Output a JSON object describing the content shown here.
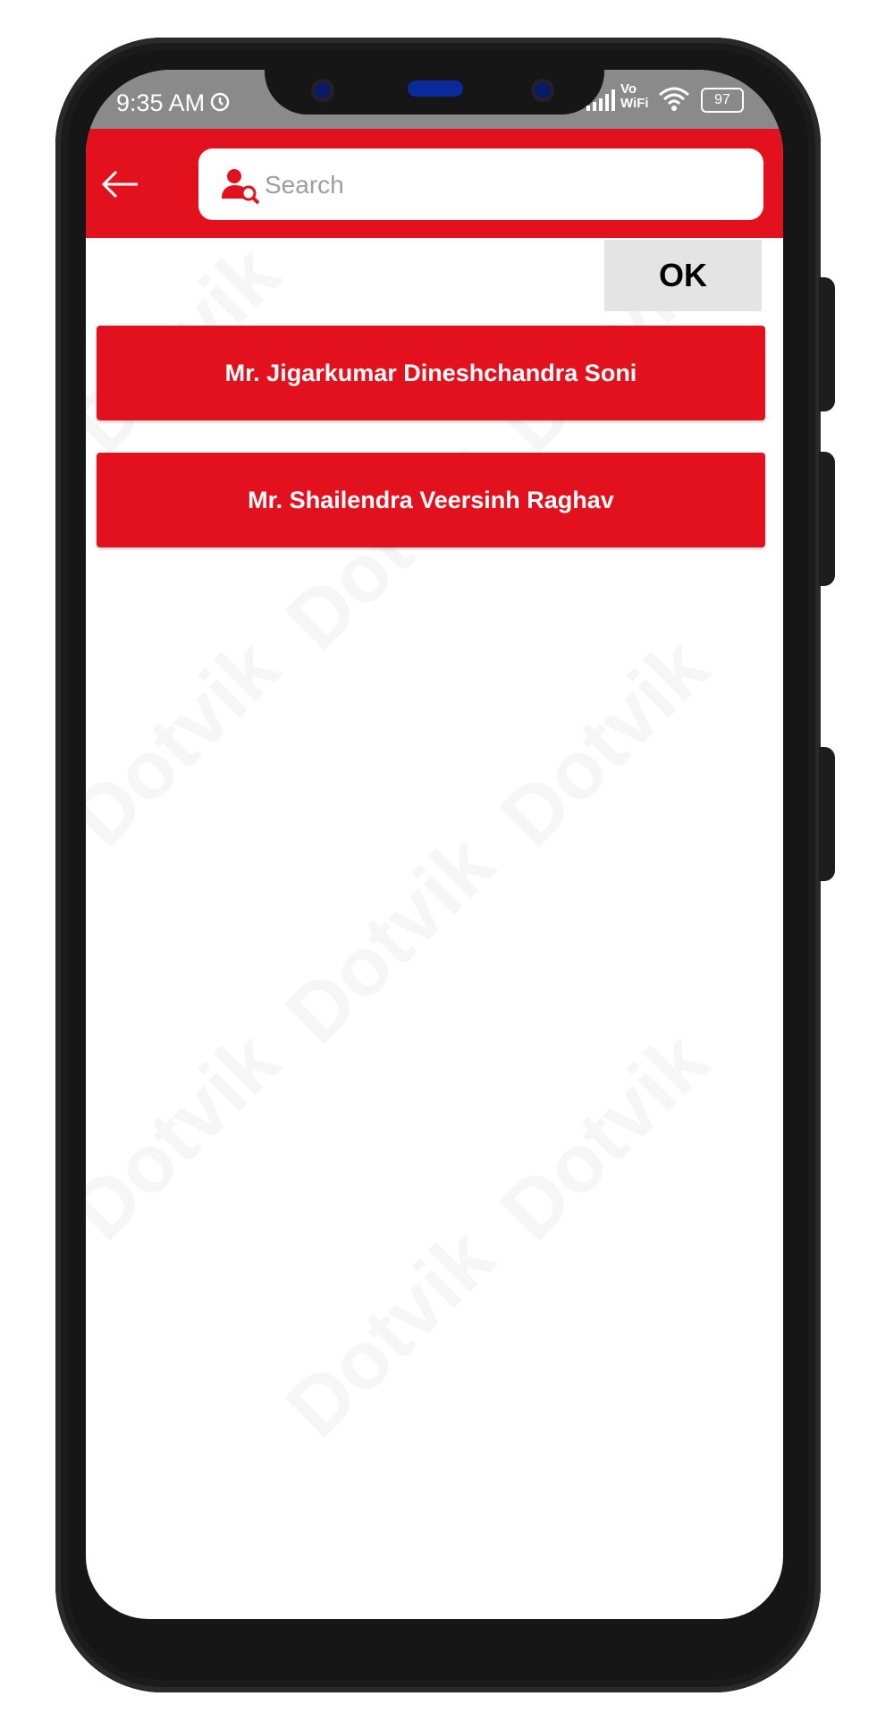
{
  "status_bar": {
    "time": "9:35 AM",
    "network_label": "Vo WiFi",
    "battery": "97"
  },
  "header": {
    "search_placeholder": "Search",
    "back_icon": "arrow-left-icon",
    "search_icon": "user-search-icon"
  },
  "actions": {
    "ok_label": "OK"
  },
  "list": {
    "items": [
      {
        "label": "Mr. Jigarkumar Dineshchandra Soni"
      },
      {
        "label": "Mr. Shailendra Veersinh Raghav"
      }
    ]
  },
  "watermark": {
    "text": "Dotvik"
  },
  "colors": {
    "accent": "#e3111d",
    "ok_bg": "#e4e4e4"
  }
}
